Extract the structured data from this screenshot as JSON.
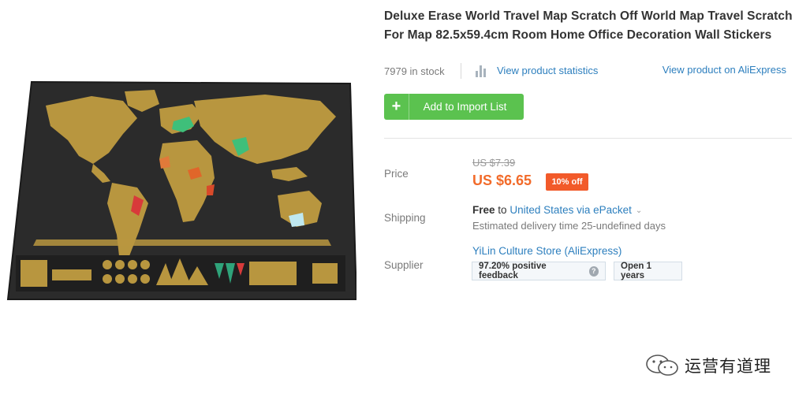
{
  "product": {
    "title": "Deluxe Erase World Travel Map Scratch Off World Map Travel Scratch For Map 82.5x59.4cm Room Home Office Decoration Wall Stickers",
    "stock": "7979 in stock",
    "stats_link": "View product statistics",
    "ali_link": "View product on AliExpress",
    "import_button": "Add to Import List",
    "image_icon": "world-map-poster"
  },
  "price": {
    "label": "Price",
    "old": "US $7.39",
    "new": "US $6.65",
    "discount": "10% off"
  },
  "shipping": {
    "label": "Shipping",
    "free": "Free",
    "to": "to",
    "destination": "United States via ePacket",
    "delivery": "Estimated delivery time 25-undefined days"
  },
  "supplier": {
    "label": "Supplier",
    "store": "YiLin Culture Store (AliExpress)",
    "feedback": "97.20% positive feedback",
    "open": "Open 1 years"
  },
  "watermark": {
    "text": "运营有道理",
    "icon": "wechat-icon"
  },
  "colors": {
    "accent_green": "#5bc24f",
    "link_blue": "#2d7fbe",
    "price_orange": "#f26b2a",
    "badge_red": "#f25a2a"
  }
}
